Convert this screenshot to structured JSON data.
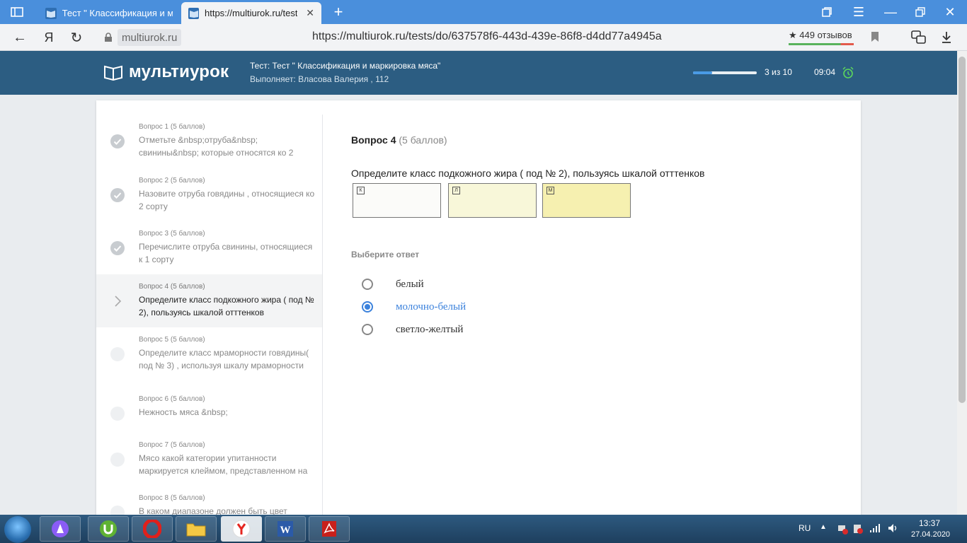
{
  "browser": {
    "tabs": [
      {
        "label": "Тест \" Классификация и ма",
        "active": false
      },
      {
        "label": "https://multiurok.ru/tests",
        "active": true
      }
    ],
    "host": "multiurok.ru",
    "url": "https://multiurok.ru/tests/do/637578f6-443d-439e-86f8-d4dd77a4945a",
    "reviews": "★ 449 отзывов",
    "yandex_letter": "Я"
  },
  "header": {
    "logo_text": "мультиурок",
    "test_title": "Тест: Тест \" Классификация и маркировка мяса\"",
    "user_line": "Выполняет: Власова Валерия , 112",
    "progress_text": "3 из 10",
    "progress_fraction": 0.3,
    "timer": "09:04"
  },
  "sidebar": {
    "items": [
      {
        "head": "Вопрос 1 (5 баллов)",
        "text": "Отметьте &nbsp;отруба&nbsp; свинины&nbsp; которые относятся ко 2",
        "status": "done"
      },
      {
        "head": "Вопрос 2 (5 баллов)",
        "text": "Назовите отруба говядины , относящиеся ко 2 сорту",
        "status": "done"
      },
      {
        "head": "Вопрос 3 (5 баллов)",
        "text": "Перечислите отруба свинины, относящиеся к 1 сорту",
        "status": "done"
      },
      {
        "head": "Вопрос 4 (5 баллов)",
        "text": "Определите класс подкожного жира ( под № 2), пользуясь шкалой отттенков",
        "status": "current"
      },
      {
        "head": "Вопрос 5 (5 баллов)",
        "text": "Определите класс мраморности говядины( под № 3) , используя шкалу мраморности",
        "status": "pending"
      },
      {
        "head": "Вопрос 6 (5 баллов)",
        "text": "Нежность мяса &nbsp;",
        "status": "pending"
      },
      {
        "head": "Вопрос 7 (5 баллов)",
        "text": "Мясо какой категории упитанности маркируется клеймом, представленном на",
        "status": "pending"
      },
      {
        "head": "Вопрос 8 (5 баллов)",
        "text": "В каком диапазоне должен быть цвет",
        "status": "pending"
      }
    ]
  },
  "question": {
    "number": "Вопрос 4",
    "points": "(5 баллов)",
    "text": "Определите класс подкожного жира ( под № 2), пользуясь шкалой  отттенков",
    "swatches": [
      {
        "label": "К",
        "color": "#fbfbf9"
      },
      {
        "label": "Л",
        "color": "#f8f7d9"
      },
      {
        "label": "М",
        "color": "#f6f0b0"
      }
    ],
    "choose_label": "Выберите ответ",
    "options": [
      {
        "label": "белый",
        "selected": false
      },
      {
        "label": "молочно-белый",
        "selected": true
      },
      {
        "label": "светло-желтый",
        "selected": false
      }
    ]
  },
  "taskbar": {
    "lang": "RU",
    "time": "13:37",
    "date": "27.04.2020"
  },
  "colors": {
    "header_bg": "#2c5d82",
    "tabstrip_bg": "#4a8fdc",
    "accent_blue": "#3c82dc",
    "done_check": "#c8ccd0"
  }
}
